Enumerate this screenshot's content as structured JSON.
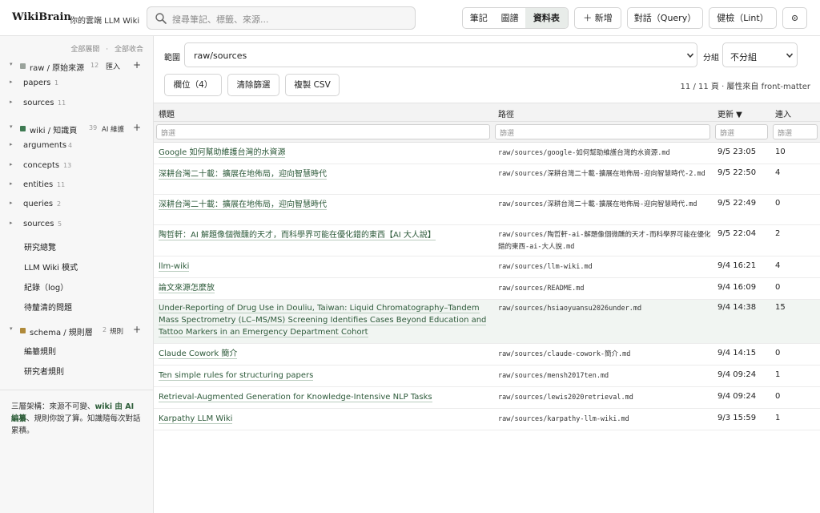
{
  "app": {
    "brand": "WikiBrain",
    "subtitle": "你的雲端 LLM Wiki"
  },
  "search": {
    "placeholder": "搜尋筆記、標籤、來源..."
  },
  "view_tabs": [
    "筆記",
    "圖譜",
    "資料表"
  ],
  "active_view": "資料表",
  "toolbar": {
    "add": "＋ 新增",
    "query": "對話（Query）",
    "lint": "健檢（Lint）",
    "settings_icon": "gear-icon"
  },
  "sidebar": {
    "expand_all": "全部展開",
    "sep": "·",
    "collapse_all": "全部收合",
    "groups": [
      {
        "label": "raw / 原始來源",
        "count": "12",
        "action": "匯入",
        "color": "#9aa39c"
      },
      {
        "label": "wiki / 知識頁",
        "count": "39",
        "action": "AI 維護",
        "color": "#3e7a52"
      },
      {
        "label": "schema / 規則層",
        "count": "2",
        "action": "規則",
        "color": "#b08a3a"
      }
    ],
    "raw_children": [
      {
        "label": "papers",
        "count": "1"
      },
      {
        "label": "sources",
        "count": "11"
      }
    ],
    "wiki_children": [
      {
        "label": "arguments",
        "count": "4"
      },
      {
        "label": "concepts",
        "count": "13"
      },
      {
        "label": "entities",
        "count": "11"
      },
      {
        "label": "queries",
        "count": "2"
      },
      {
        "label": "sources",
        "count": "5"
      }
    ],
    "wiki_pages": [
      "研究總覽",
      "LLM Wiki 模式",
      "紀錄（log）",
      "待釐清的問題"
    ],
    "schema_pages": [
      "編纂規則",
      "研究者規則"
    ],
    "note": {
      "p1": "三層架構：來源不可變、",
      "b1": "wiki 由 AI 編纂",
      "p2": "、規則你說了算。知識隨每次對話累積。"
    }
  },
  "main": {
    "scope_label": "範圍",
    "scope_value": "raw/sources",
    "group_label": "分組",
    "group_value": "不分組",
    "fields_button": "欄位（4）",
    "clear_button": "清除篩選",
    "copy_button": "複製 CSV",
    "summary": "11 / 11 頁 · 屬性來自 front-matter",
    "columns": {
      "title": "標題",
      "path": "路徑",
      "updated": "更新 ▼",
      "links": "連入"
    },
    "filter_placeholder": "篩選"
  },
  "rows": [
    {
      "title": "Google 如何幫助維護台灣的水資源",
      "path": "raw/sources/google-如何幫助維護台灣的水資源.md",
      "updated": "9/5 23:05",
      "links": "10"
    },
    {
      "title": "深耕台灣二十載：擴展在地佈局，迎向智慧時代",
      "path": "raw/sources/深耕台灣二十載-擴展在地佈局-迎向智慧時代-2.md",
      "updated": "9/5 22:50",
      "links": "4"
    },
    {
      "title": "深耕台灣二十載：擴展在地佈局，迎向智慧時代",
      "path": "raw/sources/深耕台灣二十載-擴展在地佈局-迎向智慧時代.md",
      "updated": "9/5 22:49",
      "links": "0"
    },
    {
      "title": "陶哲軒：AI 解題像個微醺的天才，而科學界可能在優化錯的東西【AI 大人說】",
      "path": "raw/sources/陶哲軒-ai-解題像個微醺的天才-而科學界可能在優化錯的東西-ai-大人說.md",
      "updated": "9/5 22:04",
      "links": "2"
    },
    {
      "title": "llm-wiki",
      "path": "raw/sources/llm-wiki.md",
      "updated": "9/4 16:21",
      "links": "4"
    },
    {
      "title": "論文來源怎麼放",
      "path": "raw/sources/README.md",
      "updated": "9/4 16:09",
      "links": "0"
    },
    {
      "title": "Under-Reporting of Drug Use in Douliu, Taiwan: Liquid Chromatography–Tandem Mass Spectrometry (LC–MS/MS) Screening Identifies Cases Beyond Education and Tattoo Markers in an Emergency Department Cohort",
      "path": "raw/sources/hsiaoyuansu2026under.md",
      "updated": "9/4 14:38",
      "links": "15"
    },
    {
      "title": "Claude Cowork 簡介",
      "path": "raw/sources/claude-cowork-簡介.md",
      "updated": "9/4 14:15",
      "links": "0"
    },
    {
      "title": "Ten simple rules for structuring papers",
      "path": "raw/sources/mensh2017ten.md",
      "updated": "9/4 09:24",
      "links": "1"
    },
    {
      "title": "Retrieval-Augmented Generation for Knowledge-Intensive NLP Tasks",
      "path": "raw/sources/lewis2020retrieval.md",
      "updated": "9/4 09:24",
      "links": "0"
    },
    {
      "title": "Karpathy LLM Wiki",
      "path": "raw/sources/karpathy-llm-wiki.md",
      "updated": "9/3 15:59",
      "links": "1"
    }
  ]
}
